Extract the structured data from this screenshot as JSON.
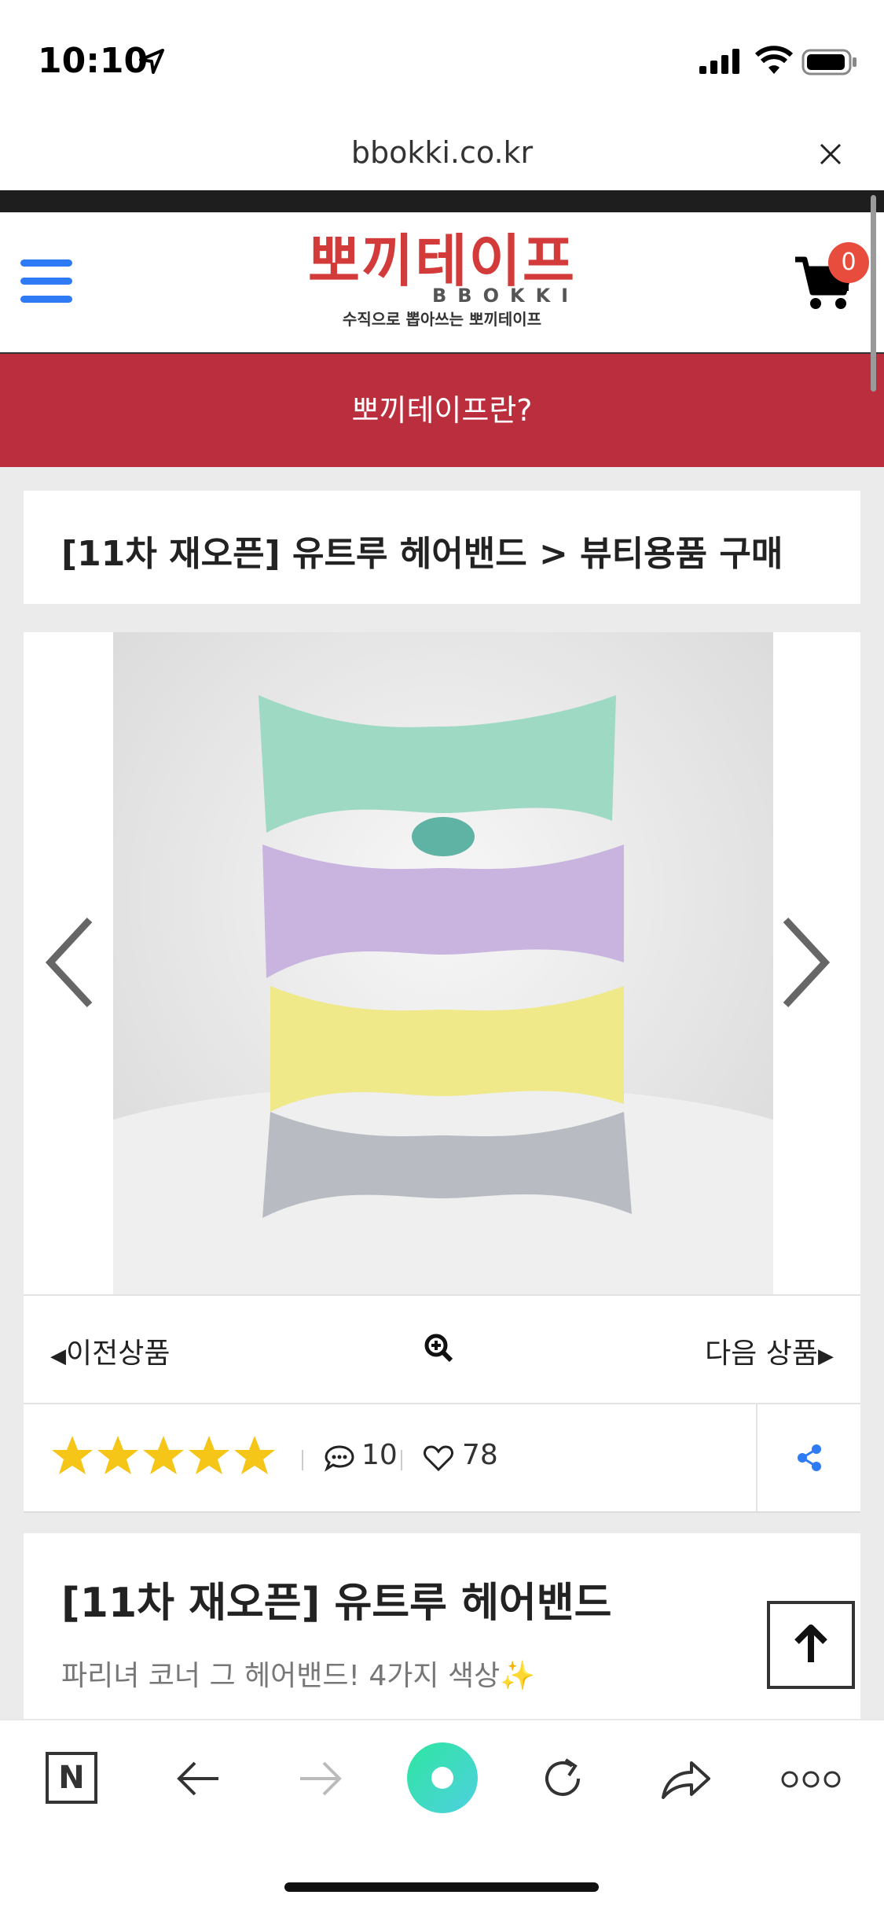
{
  "status": {
    "time": "10:10"
  },
  "browser": {
    "url": "bbokki.co.kr"
  },
  "header": {
    "logo_main": "뽀끼테이프",
    "logo_sub": "BBOKKI",
    "logo_tagline": "수직으로 뽑아쓰는 뽀끼테이프",
    "cart_count": "0",
    "menu_icon": "hamburger-icon",
    "cart_icon": "cart-icon"
  },
  "banner": {
    "label": "뽀끼테이프란?"
  },
  "breadcrumb": {
    "text": "[11차 재오픈] 유트루 헤어밴드 > 뷰티용품 구매"
  },
  "product_nav": {
    "prev_label": "이전상품",
    "next_label": "다음 상품"
  },
  "rating": {
    "stars": 5,
    "max_stars": 5,
    "comments": "10",
    "likes": "78"
  },
  "product": {
    "title": "[11차 재오픈] 유트루 헤어밴드",
    "description": "파리녀 코너 그 헤어밴드! 4가지 색상✨"
  },
  "colors": {
    "accent_red": "#bb2e3d",
    "logo_red": "#d33a3a",
    "menu_blue": "#2f7bf5",
    "star_yellow": "#f5c518",
    "badge_red": "#e74c3c"
  }
}
